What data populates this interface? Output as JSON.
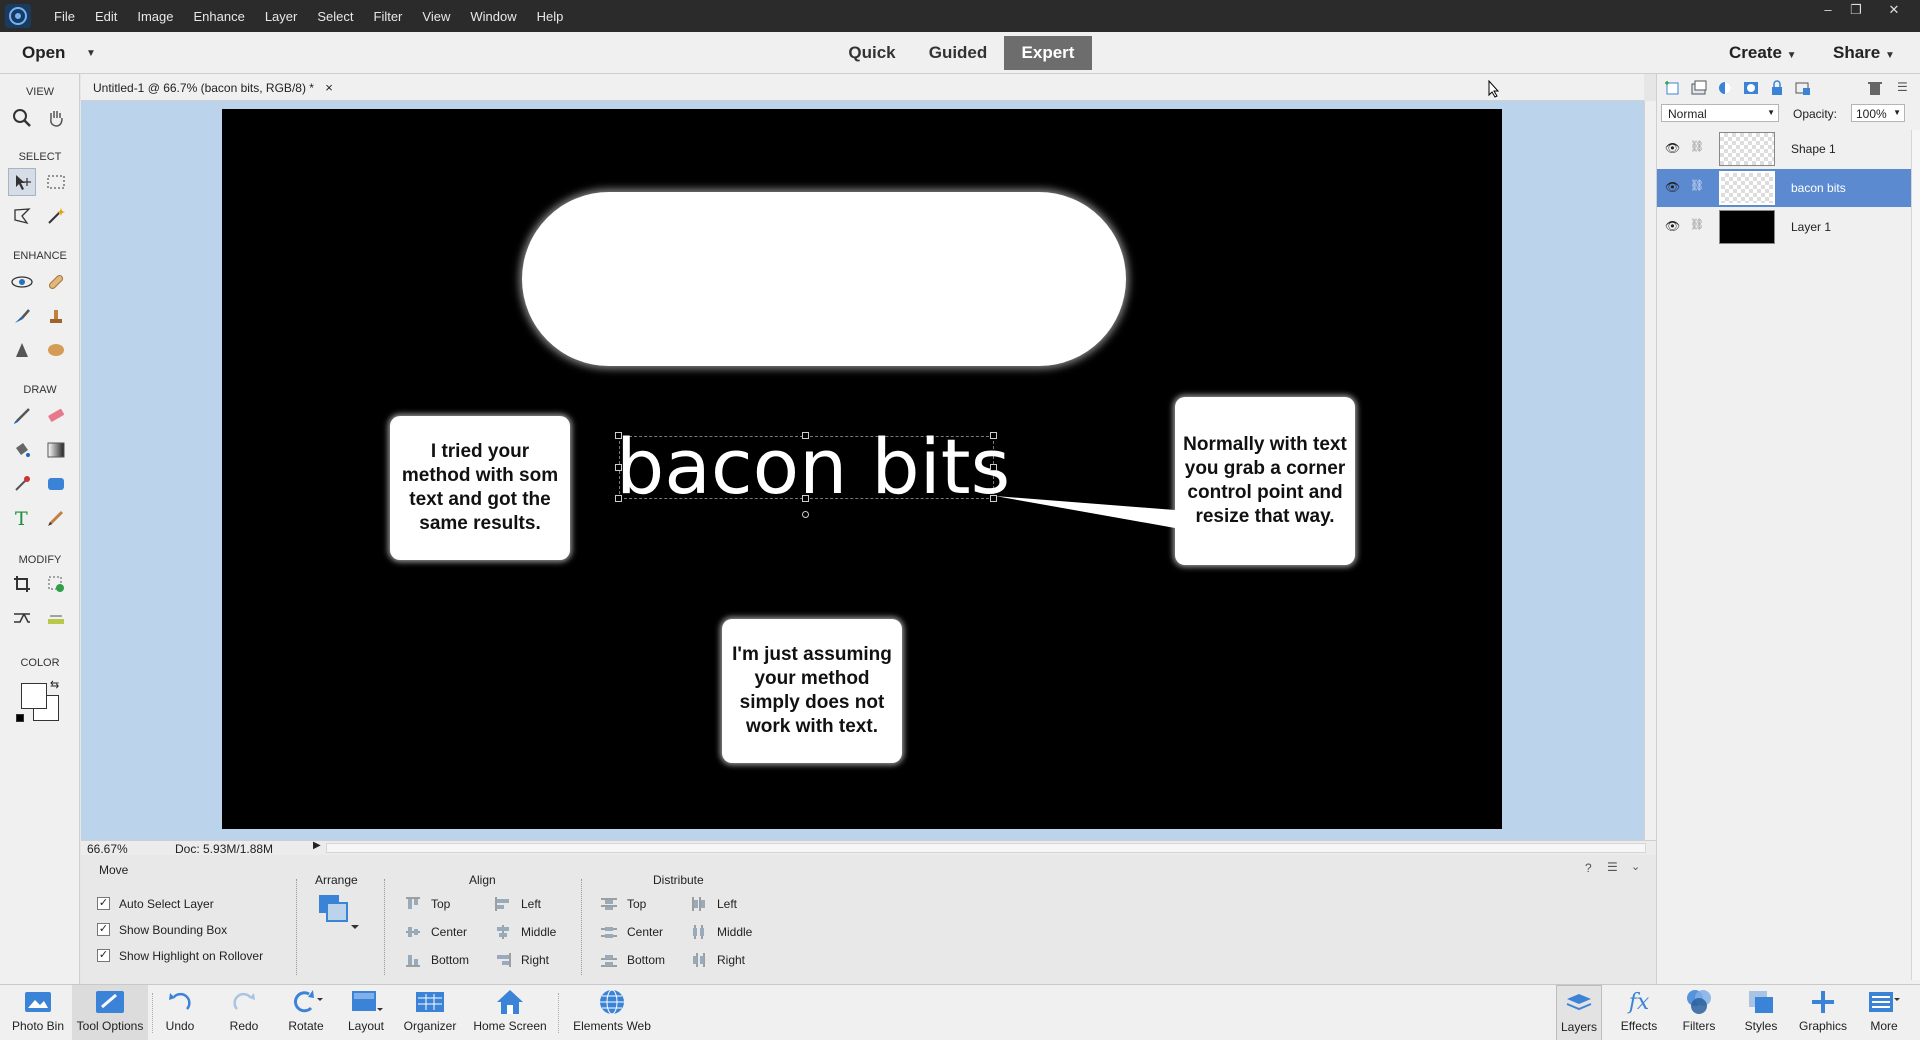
{
  "menu": [
    "File",
    "Edit",
    "Image",
    "Enhance",
    "Layer",
    "Select",
    "Filter",
    "View",
    "Window",
    "Help"
  ],
  "window_controls": {
    "minimize": "–",
    "restore": "❐",
    "close": "✕"
  },
  "modebar": {
    "open_label": "Open",
    "tabs": [
      "Quick",
      "Guided",
      "Expert"
    ],
    "active_tab": "Expert",
    "create_label": "Create",
    "share_label": "Share"
  },
  "document": {
    "tab_title": "Untitled-1 @ 66.7% (bacon bits, RGB/8) *",
    "close": "×"
  },
  "toolbox": {
    "view": "VIEW",
    "select": "SELECT",
    "enhance": "ENHANCE",
    "draw": "DRAW",
    "modify": "MODIFY",
    "color": "COLOR"
  },
  "canvas": {
    "headline": "bacon bits",
    "bubble_left": "I tried your method with som text and got the same results.",
    "bubble_right": "Normally with text you grab a corner control point and resize that way.",
    "bubble_bottom": "I'm just assuming your method simply does not work with text."
  },
  "status": {
    "zoom": "66.67%",
    "doc": "Doc: 5.93M/1.88M"
  },
  "tool_options": {
    "tool_name": "Move",
    "checkboxes": [
      {
        "label": "Auto Select Layer",
        "checked": true
      },
      {
        "label": "Show Bounding Box",
        "checked": true
      },
      {
        "label": "Show Highlight on Rollover",
        "checked": true
      }
    ],
    "arrange": "Arrange",
    "align": {
      "title": "Align",
      "items": [
        "Top",
        "Center",
        "Bottom",
        "Left",
        "Middle",
        "Right"
      ]
    },
    "distribute": {
      "title": "Distribute",
      "items": [
        "Top",
        "Center",
        "Bottom",
        "Left",
        "Middle",
        "Right"
      ]
    }
  },
  "layers_panel": {
    "blend_mode": "Normal",
    "opacity_label": "Opacity:",
    "opacity_value": "100%",
    "layers": [
      {
        "name": "Shape 1",
        "selected": false
      },
      {
        "name": "bacon bits",
        "selected": true
      },
      {
        "name": "Layer 1",
        "selected": false
      }
    ]
  },
  "taskbar": {
    "left": [
      "Photo Bin",
      "Tool Options",
      "Undo",
      "Redo",
      "Rotate",
      "Layout",
      "Organizer",
      "Home Screen",
      "Elements Web"
    ],
    "right": [
      "Layers",
      "Effects",
      "Filters",
      "Styles",
      "Graphics",
      "More"
    ]
  },
  "colors": {
    "accent": "#5c8ad1",
    "canvas_bg": "#000000",
    "workspace_bg": "#bcd3ec",
    "titlebar": "#2b2b2b"
  }
}
